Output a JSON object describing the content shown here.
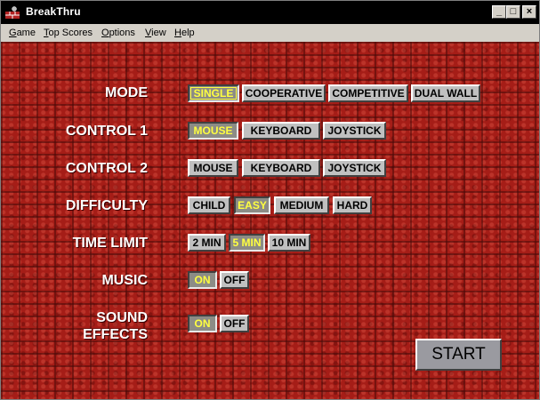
{
  "window": {
    "title": "BreakThru",
    "minimize": "_",
    "maximize": "□",
    "close": "×"
  },
  "menu": [
    "Game",
    "Top Scores",
    "Options",
    "View",
    "Help"
  ],
  "colors": {
    "selected_text": "#ffff40",
    "background": "#a51d17"
  },
  "rows": {
    "mode": {
      "label": "MODE",
      "options": [
        "SINGLE",
        "COOPERATIVE",
        "COMPETITIVE",
        "DUAL WALL"
      ],
      "selected": "SINGLE"
    },
    "control1": {
      "label": "CONTROL 1",
      "options": [
        "MOUSE",
        "KEYBOARD",
        "JOYSTICK"
      ],
      "selected": "MOUSE"
    },
    "control2": {
      "label": "CONTROL 2",
      "options": [
        "MOUSE",
        "KEYBOARD",
        "JOYSTICK"
      ],
      "selected": ""
    },
    "difficulty": {
      "label": "DIFFICULTY",
      "options": [
        "CHILD",
        "EASY",
        "MEDIUM",
        "HARD"
      ],
      "selected": "EASY"
    },
    "time_limit": {
      "label": "TIME LIMIT",
      "options": [
        "2 MIN",
        "5 MIN",
        "10 MIN"
      ],
      "selected": "5 MIN"
    },
    "music": {
      "label": "MUSIC",
      "options": [
        "ON",
        "OFF"
      ],
      "selected": "ON"
    },
    "sound_effects": {
      "label_line1": "SOUND",
      "label_line2": "EFFECTS",
      "options": [
        "ON",
        "OFF"
      ],
      "selected": "ON"
    }
  },
  "start_label": "START"
}
